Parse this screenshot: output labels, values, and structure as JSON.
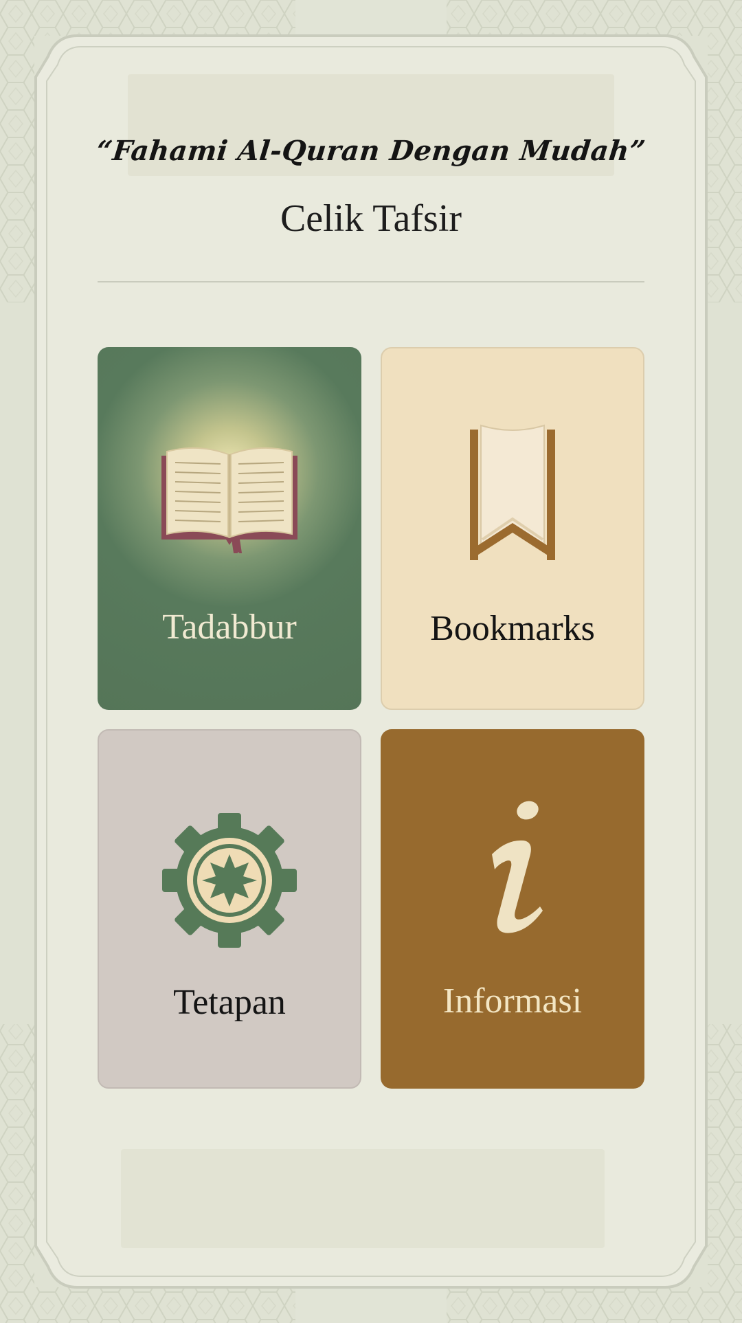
{
  "header": {
    "tagline": "“Fahami Al-Quran Dengan Mudah”",
    "title": "Celik Tafsir"
  },
  "menu": {
    "tiles": [
      {
        "label": "Tadabbur",
        "icon": "open-book-icon",
        "bg_color": "#557558",
        "text_color": "#f1ead2"
      },
      {
        "label": "Bookmarks",
        "icon": "bookmark-icon",
        "bg_color": "#f0e0bf",
        "text_color": "#141414"
      },
      {
        "label": "Tetapan",
        "icon": "gear-icon",
        "bg_color": "#d1c9c3",
        "text_color": "#141414"
      },
      {
        "label": "Informasi",
        "icon": "info-icon",
        "bg_color": "#976a2e",
        "text_color": "#f3e6c4"
      }
    ]
  },
  "theme": {
    "background": "#e4e6d9",
    "accent_green": "#557558",
    "accent_brown": "#976a2e"
  }
}
